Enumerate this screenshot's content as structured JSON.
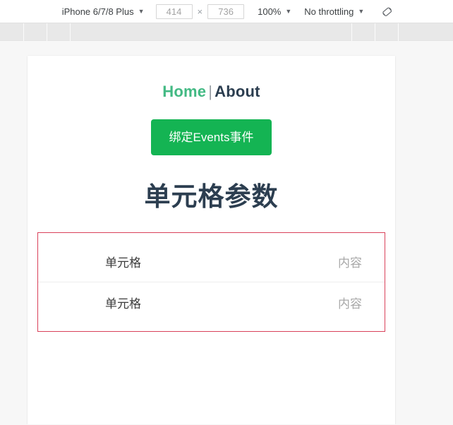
{
  "toolbar": {
    "device_name": "iPhone 6/7/8 Plus",
    "device_caret": "▼",
    "width_value": "414",
    "height_value": "736",
    "dimension_separator": "×",
    "zoom_level": "100%",
    "zoom_caret": "▼",
    "throttling": "No throttling",
    "throttle_caret": "▼",
    "rotate_icon": "rotate-device-icon"
  },
  "ruler": {
    "tick_positions": [
      33,
      66,
      99,
      498,
      531,
      564
    ]
  },
  "page": {
    "nav": {
      "home_label": "Home",
      "separator": "|",
      "about_label": "About"
    },
    "bind_events_button": "绑定Events事件",
    "title": "单元格参数",
    "cells": [
      {
        "label": "单元格",
        "value": "内容"
      },
      {
        "label": "单元格",
        "value": "内容"
      }
    ]
  },
  "colors": {
    "brand_green": "#14b453",
    "link_green": "#42b983",
    "heading_navy": "#2c3e50",
    "list_border_red": "#d9415a",
    "page_background": "#f7f7f7"
  }
}
